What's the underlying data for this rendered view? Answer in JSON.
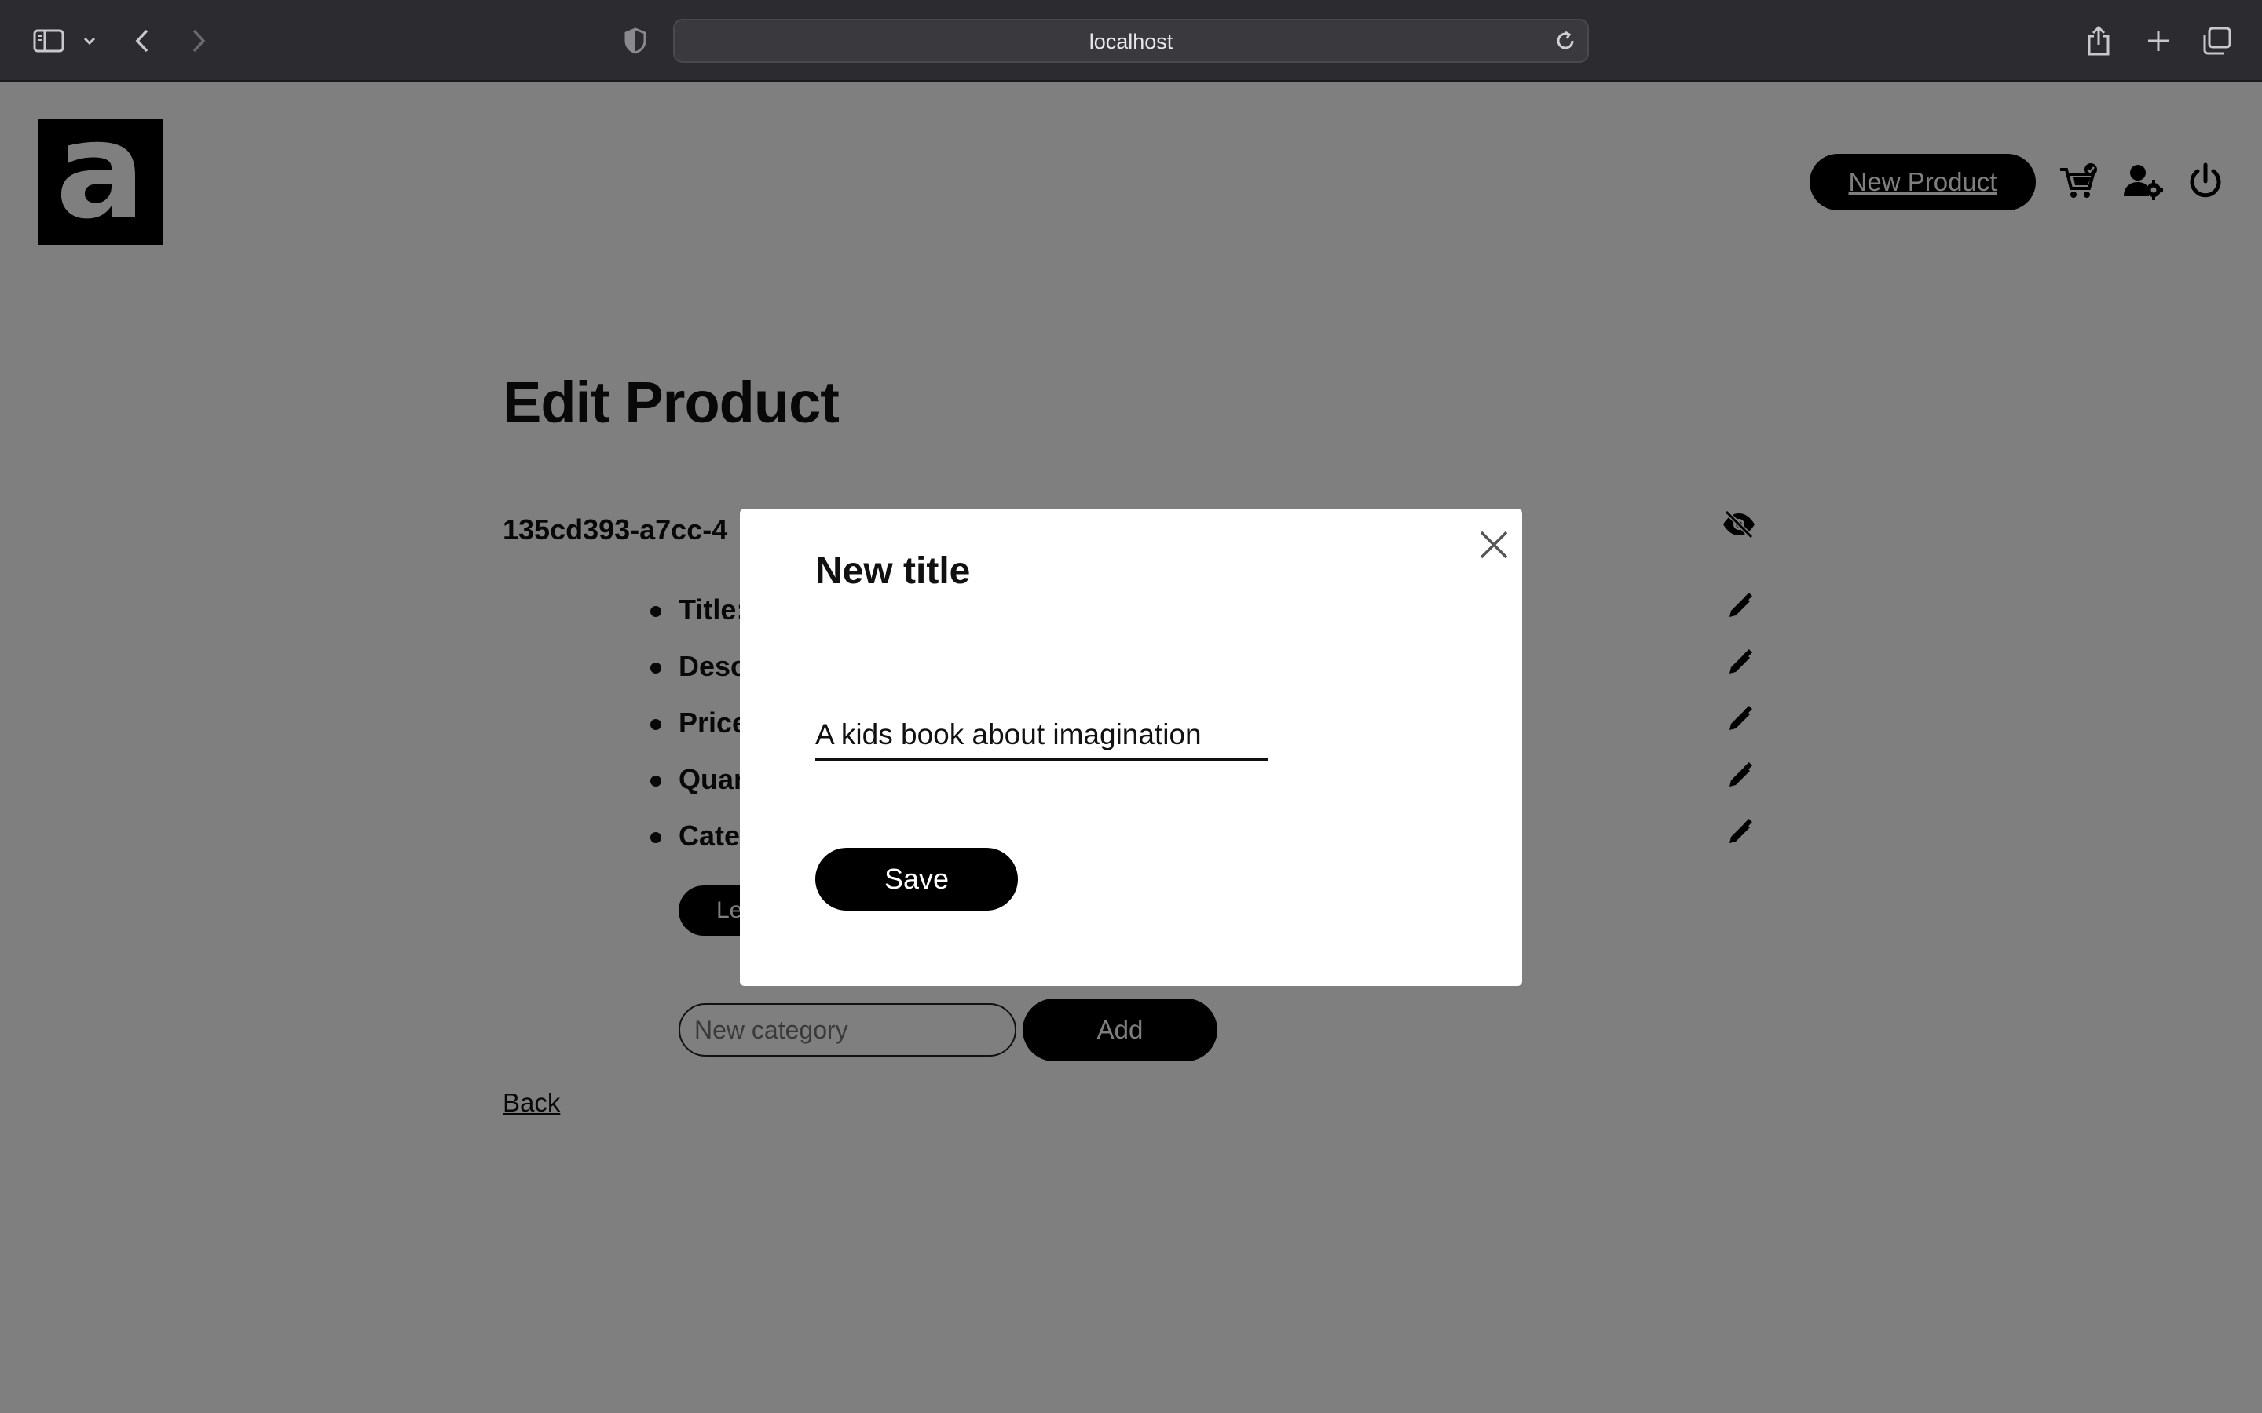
{
  "browser": {
    "url": "localhost"
  },
  "header": {
    "logo_text": "a",
    "new_product_label": "New Product"
  },
  "main": {
    "page_title": "Edit Product",
    "product_id": "135cd393-a7cc-4",
    "fields": [
      {
        "label": "Title:"
      },
      {
        "label": "Desc"
      },
      {
        "label": "Price"
      },
      {
        "label": "Quan"
      },
      {
        "label": "Cate"
      }
    ],
    "category_chip": "Le",
    "new_category_placeholder": "New category",
    "add_label": "Add",
    "back_label": "Back"
  },
  "modal": {
    "title": "New title",
    "input_value": "A kids book about imagination",
    "save_label": "Save"
  },
  "colors": {
    "chrome_bg": "#2c2b30",
    "accent": "#000000",
    "overlay": "rgba(0,0,0,0.5)"
  }
}
